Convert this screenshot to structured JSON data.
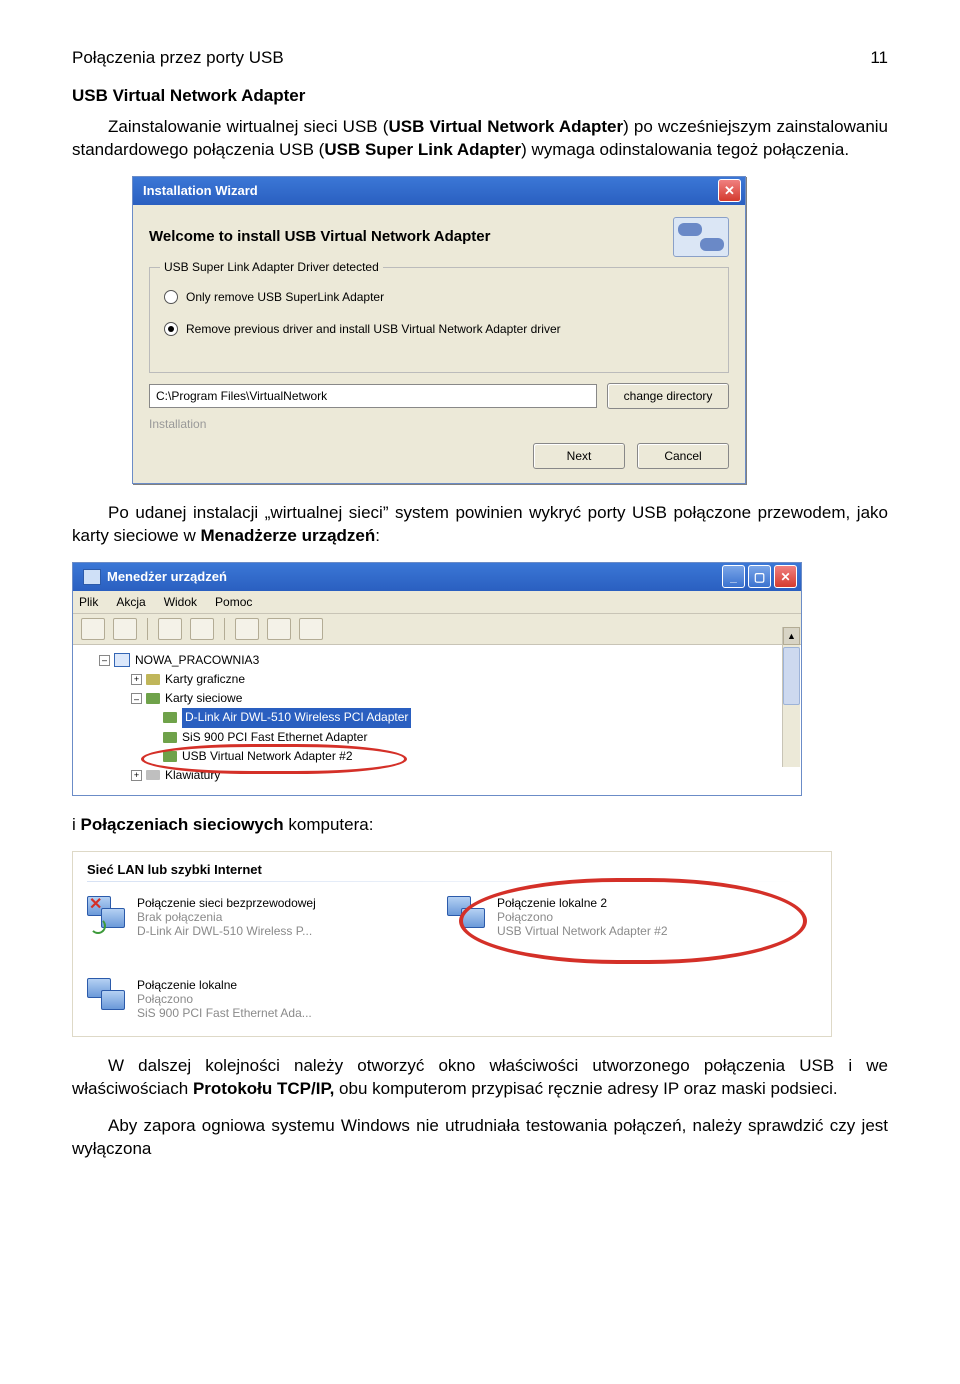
{
  "header": {
    "title": "Połączenia przez porty USB",
    "page": "11"
  },
  "subtitle": "USB Virtual Network Adapter",
  "p1_a": "Zainstalowanie wirtualnej sieci USB (",
  "p1_b": "USB Virtual Network Adapter",
  "p1_c": ") po wcześniejszym zainstalowaniu standardowego połączenia USB (",
  "p1_d": "USB Super Link Adapter",
  "p1_e": ") wymaga odinstalowania tegoż połączenia.",
  "wizard": {
    "title": "Installation    Wizard",
    "banner": "Welcome to install USB Virtual Network Adapter",
    "group_legend": "USB Super Link Adapter Driver detected",
    "opt1": "Only remove USB SuperLink Adapter",
    "opt2": "Remove previous driver and install USB Virtual Network Adapter driver",
    "path": "C:\\Program Files\\VirtualNetwork",
    "btn_dir": "change directory",
    "install": "Installation",
    "btn_next": "Next",
    "btn_cancel": "Cancel"
  },
  "p2": "Po udanej instalacji „wirtualnej sieci” system powinien wykryć porty USB połączone przewodem, jako karty sieciowe w ",
  "p2_b": "Menadżerze urządzeń",
  "p2_c": ":",
  "devmgr": {
    "title": "Menedżer urządzeń",
    "menu": [
      "Plik",
      "Akcja",
      "Widok",
      "Pomoc"
    ],
    "root": "NOWA_PRACOWNIA3",
    "n1": "Karty graficzne",
    "n2": "Karty sieciowe",
    "a1": "D-Link Air DWL-510 Wireless PCI Adapter",
    "a2": "SiS 900 PCI Fast Ethernet Adapter",
    "a3": "USB Virtual Network Adapter #2",
    "n3": "Klawiatury"
  },
  "p3_a": "i ",
  "p3_b": "Połączeniach sieciowych",
  "p3_c": " komputera:",
  "netconn": {
    "section": "Sieć LAN lub szybki Internet",
    "c1": {
      "l1": "Połączenie sieci bezprzewodowej",
      "l2": "Brak połączenia",
      "l3": "D-Link Air DWL-510 Wireless P..."
    },
    "c2": {
      "l1": "Połączenie lokalne 2",
      "l2": "Połączono",
      "l3": "USB Virtual Network Adapter #2"
    },
    "c3": {
      "l1": "Połączenie lokalne",
      "l2": "Połączono",
      "l3": "SiS 900 PCI Fast Ethernet Ada..."
    }
  },
  "p4_a": "W dalszej kolejności należy otworzyć okno właściwości utworzonego połączenia USB i we właściwościach ",
  "p4_b": "Protokołu TCP/IP,",
  "p4_c": " obu komputerom przypisać ręcznie adresy IP oraz maski podsieci.",
  "p5": "Aby zapora ogniowa systemu Windows nie utrudniała testowania połączeń, należy sprawdzić czy jest wyłączona"
}
